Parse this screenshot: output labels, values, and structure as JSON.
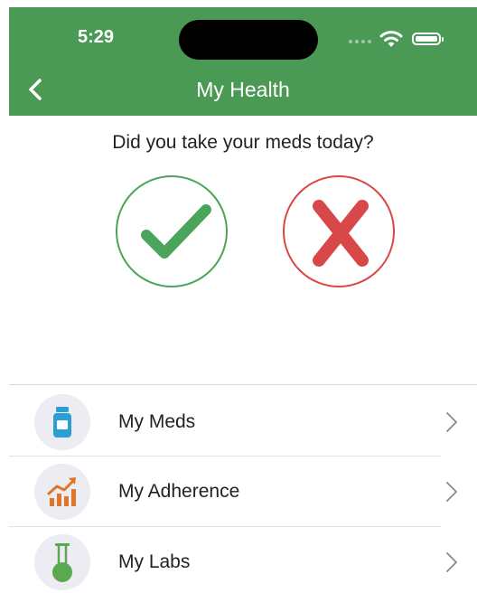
{
  "status_bar": {
    "time": "5:29"
  },
  "header": {
    "title": "My Health",
    "back_icon": "chevron-left-icon"
  },
  "prompt": {
    "question": "Did you take your meds today?",
    "yes_icon": "checkmark-icon",
    "no_icon": "x-mark-icon"
  },
  "menu": {
    "items": [
      {
        "label": "My Meds",
        "icon": "pill-bottle-icon"
      },
      {
        "label": "My Adherence",
        "icon": "trend-chart-icon"
      },
      {
        "label": "My Labs",
        "icon": "flask-icon"
      }
    ]
  },
  "colors": {
    "header_bg": "#4a9a55",
    "yes": "#4aa55a",
    "no": "#d94848",
    "meds_icon": "#2b9fd1",
    "adherence_icon": "#e0762a",
    "labs_icon": "#5aa84f"
  }
}
